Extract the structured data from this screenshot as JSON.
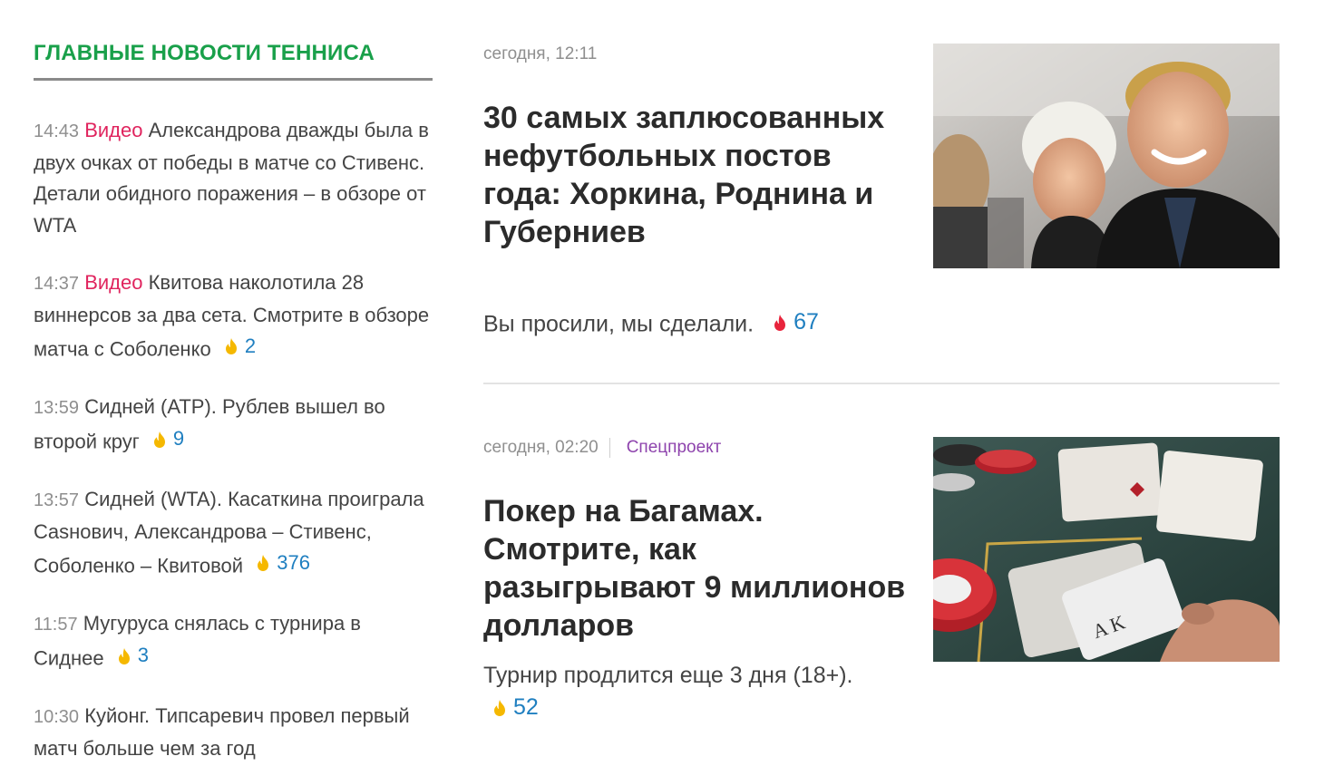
{
  "sidebar": {
    "title": "ГЛАВНЫЕ НОВОСТИ ТЕННИСА",
    "items": [
      {
        "time": "14:43",
        "tag": "Видео",
        "text": "Александрова дважды была в двух очках от победы в матче со Стивенс. Детали обидного поражения – в обзоре от WTA",
        "comments": ""
      },
      {
        "time": "14:37",
        "tag": "Видео",
        "text": "Квитова наколотила 28 виннерсов за два сета. Смотрите в обзоре матча с Соболенко",
        "comments": "2"
      },
      {
        "time": "13:59",
        "tag": "",
        "text": "Сидней (ATP). Рублев вышел во второй круг",
        "comments": "9"
      },
      {
        "time": "13:57",
        "tag": "",
        "text": "Сидней (WTA). Касаткина проиграла Сasнович, Александрова – Стивенс, Соболенко – Квитовой",
        "comments": "376"
      },
      {
        "time": "11:57",
        "tag": "",
        "text": "Мугуруса снялась с турнира в Сиднее",
        "comments": "3"
      },
      {
        "time": "10:30",
        "tag": "",
        "text": "Куйонг. Типсаревич провел первый матч больше чем за год",
        "comments": ""
      }
    ]
  },
  "articles": [
    {
      "meta": "сегодня, 12:11",
      "tag": "",
      "title": "30 самых заплюсованных нефутбольных постов года: Хоркина, Роднина и Губерниев",
      "lead": "Вы просили, мы сделали.",
      "comments": "67",
      "image_alt": "photo-couple-event"
    },
    {
      "meta": "сегодня, 02:20",
      "tag": "Спецпроект",
      "title": "Покер на Багамах. Смотрите, как разыгрывают 9 миллионов долларов",
      "lead": "Турнир продлится еще 3 дня (18+).",
      "comments": "52",
      "image_alt": "photo-poker-table"
    }
  ],
  "colors": {
    "section_title": "#19a04a",
    "video_tag": "#e0245e",
    "comment_count": "#1f7fc0",
    "special_tag": "#8e44ad",
    "flame_yellow": "#f5b800",
    "flame_red": "#e8243c"
  },
  "icons": {
    "comment_flame": "flame-icon",
    "hot_flame": "hot-flame-icon"
  }
}
